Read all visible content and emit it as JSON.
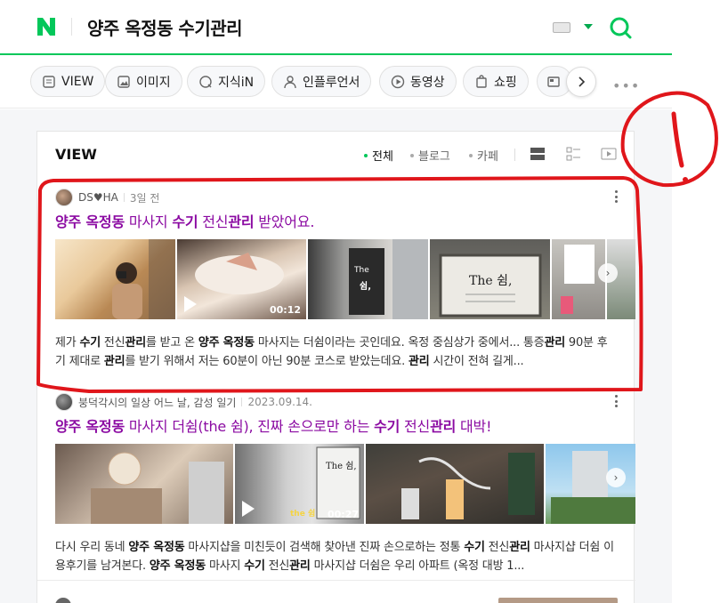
{
  "header": {
    "query": "양주 옥정동 수기관리",
    "accent_color": "#03c75a"
  },
  "tabs": [
    {
      "label": "VIEW",
      "icon": "view-icon"
    },
    {
      "label": "이미지",
      "icon": "image-icon"
    },
    {
      "label": "지식iN",
      "icon": "knowledge-icon"
    },
    {
      "label": "인플루언서",
      "icon": "person-icon"
    },
    {
      "label": "동영상",
      "icon": "play-icon"
    },
    {
      "label": "쇼핑",
      "icon": "shopping-bag-icon"
    }
  ],
  "more_label": "•••",
  "section": {
    "title": "VIEW",
    "filters": [
      {
        "label": "전체",
        "active": true
      },
      {
        "label": "블로그",
        "active": false
      },
      {
        "label": "카페",
        "active": false
      }
    ]
  },
  "posts": [
    {
      "author": "DS♥HA",
      "time": "3일 전",
      "title_parts": [
        {
          "t": "양주 옥정동",
          "b": true
        },
        {
          "t": " 마사지 ",
          "b": false
        },
        {
          "t": "수기",
          "b": true
        },
        {
          "t": " 전신",
          "b": false
        },
        {
          "t": "관리",
          "b": true
        },
        {
          "t": " 받았어요.",
          "b": false
        }
      ],
      "video_duration": "00:12",
      "desc_parts": [
        {
          "t": "제가 ",
          "b": false
        },
        {
          "t": "수기",
          "b": true
        },
        {
          "t": " 전신",
          "b": false
        },
        {
          "t": "관리",
          "b": true
        },
        {
          "t": "를 받고 온 ",
          "b": false
        },
        {
          "t": "양주 옥정동",
          "b": true
        },
        {
          "t": " 마사지는 더쉼이라는 곳인데요. 옥정 중심상가 중에서... 통증",
          "b": false
        },
        {
          "t": "관리",
          "b": true
        },
        {
          "t": " 90분 후기 제대로 ",
          "b": false
        },
        {
          "t": "관리",
          "b": true
        },
        {
          "t": "를 받기 위해서 저는 60분이 아닌 90분 코스로 받았는데요. ",
          "b": false
        },
        {
          "t": "관리",
          "b": true
        },
        {
          "t": " 시간이 전혀 길게...",
          "b": false
        }
      ]
    },
    {
      "author": "붕덕각시의 일상 어느 날, 감성 일기",
      "time": "2023.09.14.",
      "title_parts": [
        {
          "t": "양주 옥정동",
          "b": true
        },
        {
          "t": " 마사지 더쉼(the 쉼), 진짜 손으로만 하는 ",
          "b": false
        },
        {
          "t": "수기",
          "b": true
        },
        {
          "t": " 전신",
          "b": false
        },
        {
          "t": "관리",
          "b": true
        },
        {
          "t": " 대박!",
          "b": false
        }
      ],
      "video_duration": "00:27",
      "video_caption": "the 쉼",
      "desc_parts": [
        {
          "t": "다시 우리 동네 ",
          "b": false
        },
        {
          "t": "양주 옥정동",
          "b": true
        },
        {
          "t": " 마사지샵을 미친듯이 검색해 찾아낸 진짜 손으로하는 정통 ",
          "b": false
        },
        {
          "t": "수기",
          "b": true
        },
        {
          "t": " 전신",
          "b": false
        },
        {
          "t": "관리",
          "b": true
        },
        {
          "t": " 마사지샵 더쉼 이용후기를 남겨본다. ",
          "b": false
        },
        {
          "t": "양주 옥정동",
          "b": true
        },
        {
          "t": " 마사지 ",
          "b": false
        },
        {
          "t": "수기",
          "b": true
        },
        {
          "t": " 전신",
          "b": false
        },
        {
          "t": "관리",
          "b": true
        },
        {
          "t": " 마사지샵 더쉼은 우리 아파트 (옥정 대방 1...",
          "b": false
        }
      ]
    }
  ],
  "thumb_text": {
    "sign_the": "The",
    "sign_shim": "쉼,",
    "board_title": "The 쉼,"
  },
  "annotation": {
    "mark": "!",
    "color": "#e0161b"
  }
}
